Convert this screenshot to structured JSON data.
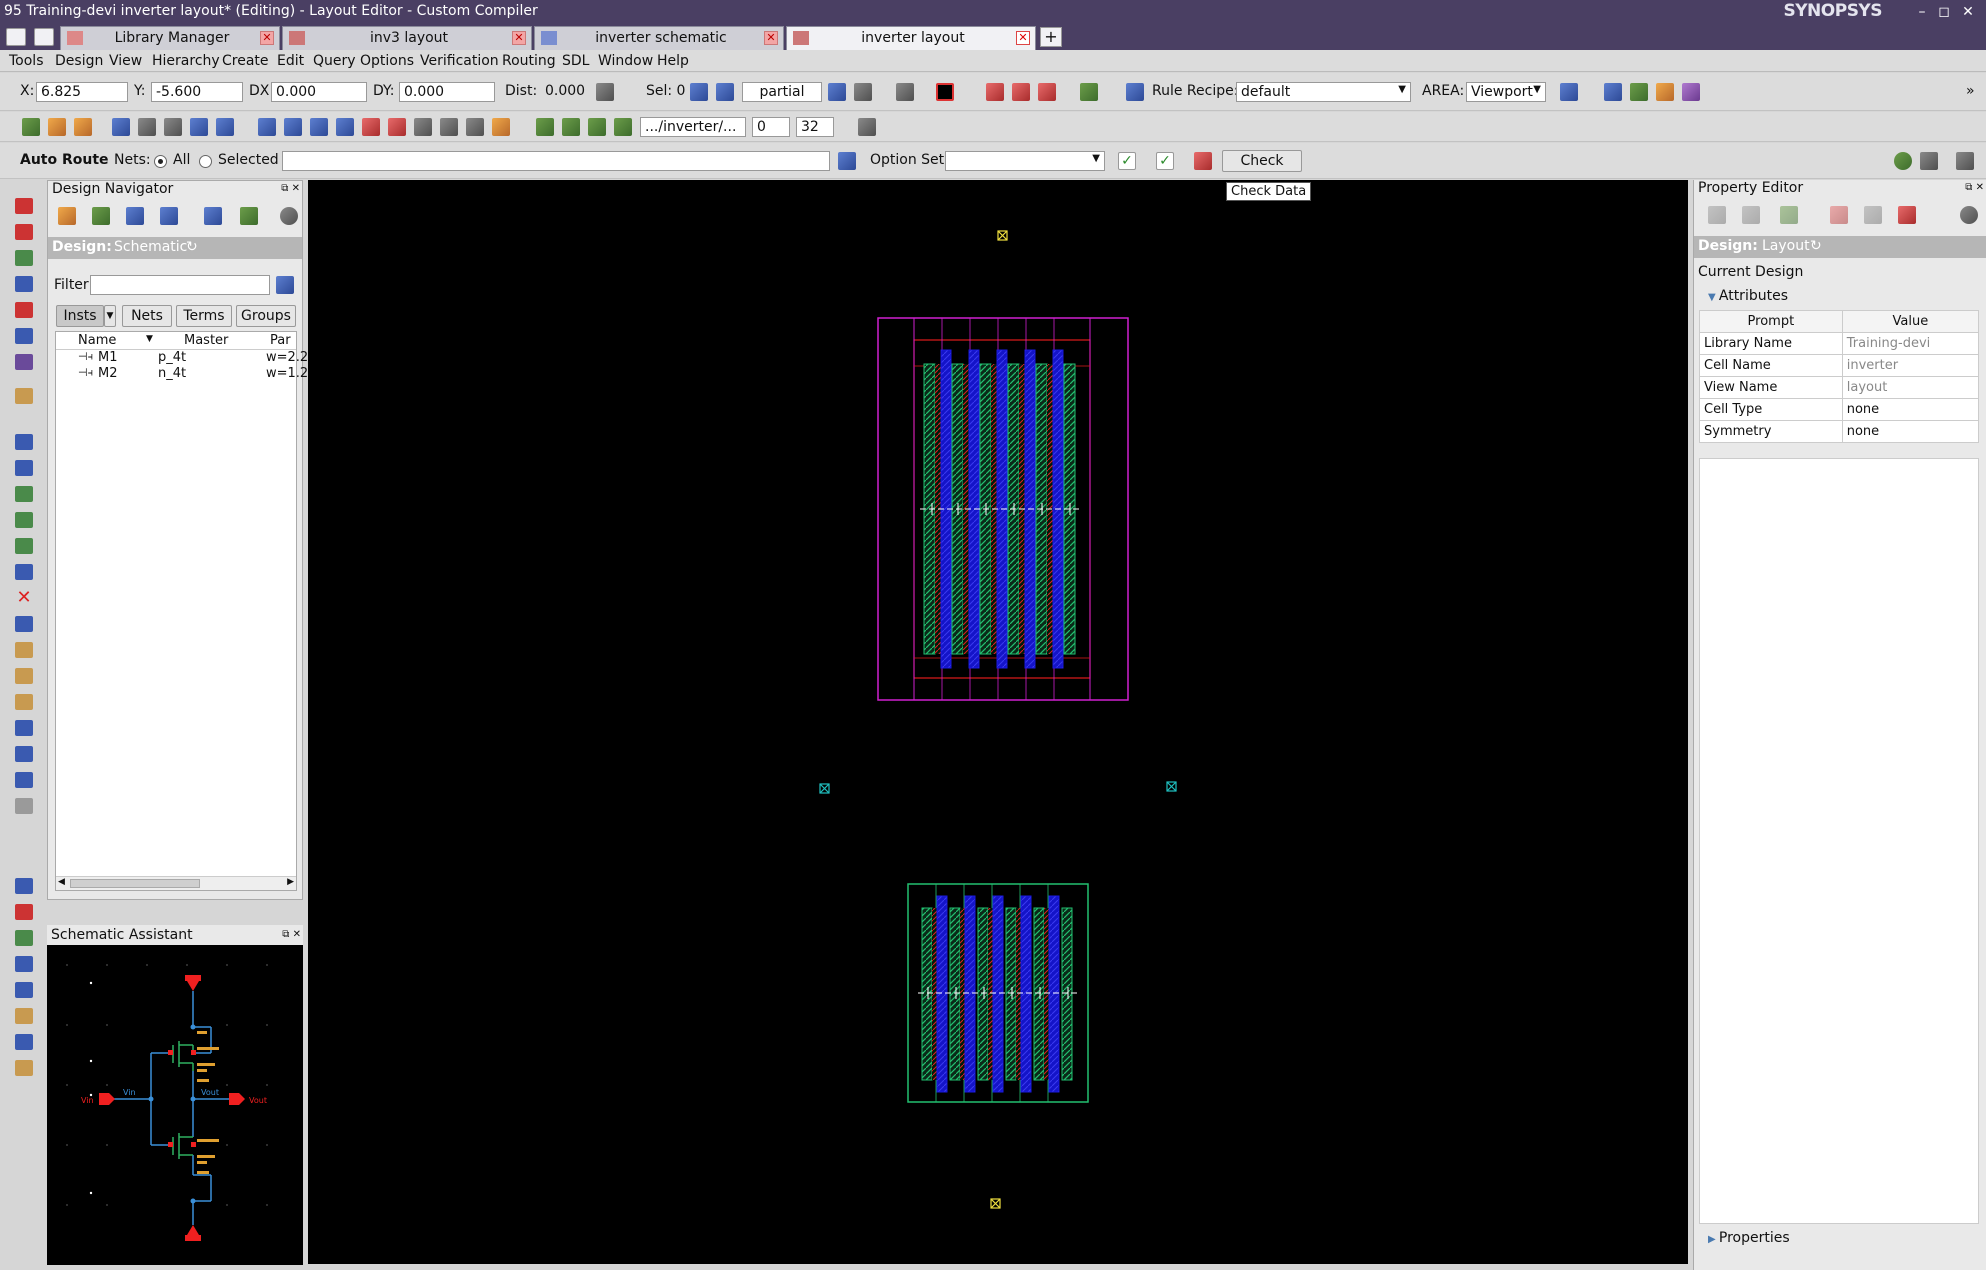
{
  "window": {
    "title": "95 Training-devi inverter layout* (Editing) - Layout Editor - Custom Compiler",
    "brand": "SYNOPSYS"
  },
  "tabs": [
    {
      "label": "Library Manager"
    },
    {
      "label": "inv3 layout"
    },
    {
      "label": "inverter schematic"
    },
    {
      "label": "inverter layout"
    }
  ],
  "menu": [
    "Tools",
    "Design",
    "View",
    "Hierarchy",
    "Create",
    "Edit",
    "Query",
    "Options",
    "Verification",
    "Routing",
    "SDL",
    "Window",
    "Help"
  ],
  "coords": {
    "x_label": "X:",
    "x_value": "6.825",
    "y_label": "Y:",
    "y_value": "-5.600",
    "dx_label": "DX:",
    "dx_value": "0.000",
    "dy_label": "DY:",
    "dy_value": "0.000",
    "dist_label": "Dist:",
    "dist_value": "0.000",
    "sel_label": "Sel: 0",
    "partial": "partial",
    "rule_recipe_label": "Rule Recipe:",
    "rule_recipe_value": "default",
    "area_label": "AREA:",
    "area_value": "Viewport"
  },
  "toolbar2": {
    "path": ".../inverter/...",
    "level_from": "0",
    "level_to": "32"
  },
  "autoroute": {
    "title": "Auto Route",
    "nets_label": "Nets:",
    "all_label": "All",
    "selected_label": "Selected",
    "option_set_label": "Option Set:",
    "check_label": "Check",
    "tooltip": "Check Data"
  },
  "design_navigator": {
    "title": "Design Navigator",
    "design_label": "Design:",
    "design_value": "Schematic",
    "filter_label": "Filter:",
    "tabs": [
      "Insts",
      "Nets",
      "Terms",
      "Groups"
    ],
    "columns": [
      "Name",
      "Master",
      "Par"
    ],
    "rows": [
      {
        "name": "M1",
        "master": "p_4t",
        "param": "w=2.2"
      },
      {
        "name": "M2",
        "master": "n_4t",
        "param": "w=1.2"
      }
    ]
  },
  "schematic_assistant": {
    "title": "Schematic Assistant",
    "labels": {
      "vin": "Vin",
      "vout": "Vout",
      "vin_net": "Vin",
      "vout_net": "Vout"
    }
  },
  "property_editor": {
    "title": "Property Editor",
    "design_label": "Design:",
    "design_value": "Layout",
    "current_design": "Current Design",
    "attributes_label": "Attributes",
    "col_prompt": "Prompt",
    "col_value": "Value",
    "rows": [
      {
        "prompt": "Library Name",
        "value": "Training-devi"
      },
      {
        "prompt": "Cell Name",
        "value": "inverter"
      },
      {
        "prompt": "View Name",
        "value": "layout"
      },
      {
        "prompt": "Cell Type",
        "value": "none"
      },
      {
        "prompt": "Symmetry",
        "value": "none"
      }
    ],
    "properties_label": "Properties"
  },
  "colors": {
    "accent": "#4a3f63",
    "canvas": "#000000",
    "nwell": "#d020d0",
    "poly": "#1a1ae0",
    "diff": "#22c070",
    "implant_red": "#e01a1a",
    "pin_marker": "#f0e040",
    "ref_marker": "#20c0c0"
  }
}
